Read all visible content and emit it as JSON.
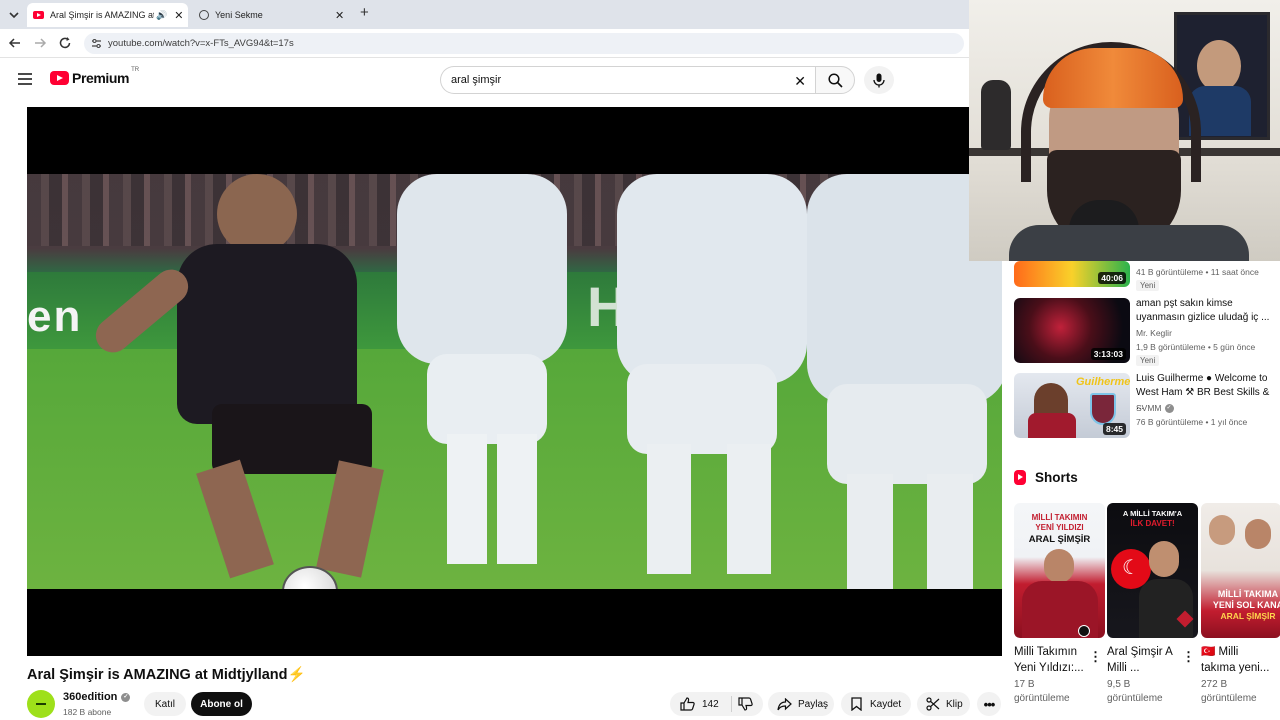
{
  "browser": {
    "tabs": [
      {
        "title": "Aral Şimşir is AMAZING at !",
        "active": true
      },
      {
        "title": "Yeni Sekme",
        "active": false
      }
    ],
    "url": "youtube.com/watch?v=x-FTs_AVG94&t=17s"
  },
  "youtube": {
    "logo_text": "Premium",
    "logo_region": "TR",
    "search_query": "aral şimşir"
  },
  "video": {
    "title": "Aral Şimşir is AMAZING at Midtjylland⚡",
    "channel": "360edition",
    "subscribers": "182 B abone",
    "join_label": "Katıl",
    "subscribe_label": "Abone ol",
    "likes": "142",
    "share_label": "Paylaş",
    "save_label": "Kaydet",
    "clip_label": "Klip"
  },
  "sidebar": {
    "videos": [
      {
        "title": "",
        "channel": "",
        "meta": "41 B görüntüleme • 11 saat önce",
        "duration": "40:06",
        "badge": "Yeni"
      },
      {
        "title": "aman pşt sakın kimse uyanmasın gizlice uludağ iç ...",
        "channel": "Mr. Keglir",
        "meta": "1,9 B görüntüleme • 5 gün önce",
        "duration": "3:13:03",
        "badge": "Yeni"
      },
      {
        "title": "Luis Guilherme ● Welcome to West Ham ⚒ BR Best Skills & ...",
        "channel": "SVMM",
        "meta": "76 B görüntüleme • 1 yıl önce",
        "duration": "8:45",
        "badge": ""
      }
    ],
    "shorts_heading": "Shorts",
    "shorts": [
      {
        "title_line1": "Milli Takımın",
        "title_line2": "Yeni Yıldızı:...",
        "views_line1": "17 B",
        "views_line2": "görüntüleme",
        "thumb_text1": "MİLLİ TAKIMIN",
        "thumb_text2": "YENİ YILDIZI",
        "thumb_text3": "ARAL ŞİMŞİR"
      },
      {
        "title_line1": "Aral Şimşir A",
        "title_line2": "Milli ...",
        "views_line1": "9,5 B",
        "views_line2": "görüntüleme",
        "thumb_text1": "A MİLLİ TAKIM'A",
        "thumb_text2": "İLK DAVET!",
        "thumb_text3": ""
      },
      {
        "title_line1": "🇹🇷 Milli",
        "title_line2": "takıma yeni...",
        "views_line1": "272 B",
        "views_line2": "görüntüleme",
        "thumb_text1": "MİLLİ TAKIMA",
        "thumb_text2": "YENİ SOL KANA",
        "thumb_text3": "ARAL ŞİMŞİR"
      }
    ],
    "thumb2_text": "Guilherme"
  },
  "colors": {
    "yt_red": "#ff0033",
    "subscribe_bg": "#0f0f0f",
    "tab_bg": "#dfe3ea"
  }
}
